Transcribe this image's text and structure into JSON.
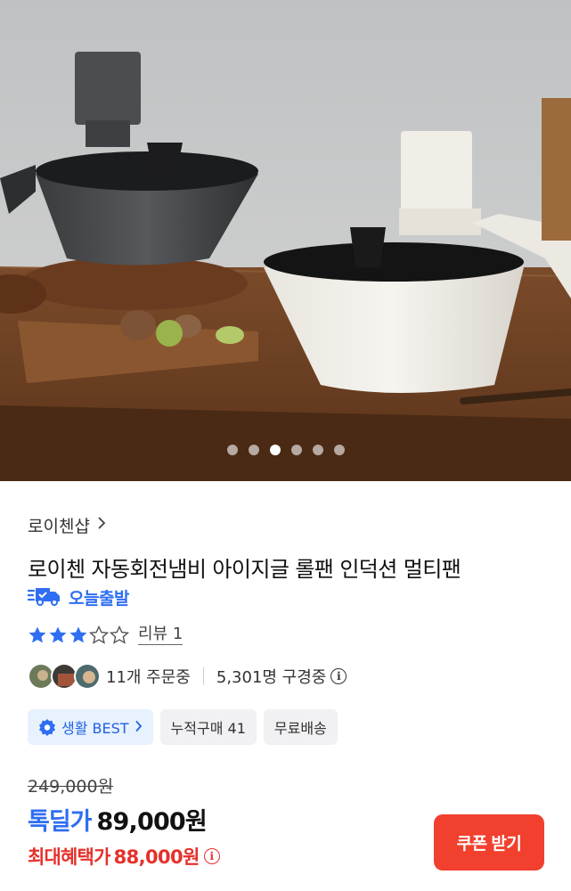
{
  "gallery": {
    "image_alt": "product photo",
    "dots_count": 6,
    "active_dot": 2
  },
  "store": {
    "name": "로이첸샵",
    "chevron": "chevron-right-icon"
  },
  "product": {
    "title": "로이첸 자동회전냄비 아이지글 롤팬 인덕션 멀티팬"
  },
  "dispatch": {
    "label": "오늘출발",
    "icon": "fast-truck-icon"
  },
  "rating": {
    "stars_filled": 3,
    "stars_total": 5,
    "review_label": "리뷰 1"
  },
  "orders": {
    "order_count": "11개 주문중",
    "viewers": "5,301명 구경중",
    "info_icon": "info-icon"
  },
  "tags": [
    {
      "label": "생활 BEST",
      "icon": "best-badge-icon"
    },
    {
      "label": "누적구매 41"
    },
    {
      "label": "무료배송"
    }
  ],
  "price": {
    "original": "249,000원",
    "sale_label": "톡딜가",
    "sale_price": "89,000원",
    "max_label": "최대혜택가",
    "max_price": "88,000원"
  },
  "coupon_button": {
    "label": "쿠폰 받기"
  },
  "colors": {
    "accent_blue": "#2f6ef2",
    "accent_red": "#e6312c",
    "button_red": "#f2402e"
  }
}
